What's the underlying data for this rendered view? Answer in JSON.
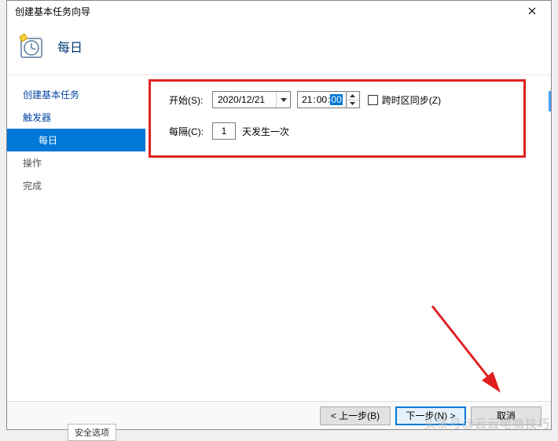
{
  "window": {
    "title": "创建基本任务向导"
  },
  "header": {
    "heading": "每日"
  },
  "sidebar": {
    "items": [
      {
        "label": "创建基本任务"
      },
      {
        "label": "触发器"
      },
      {
        "label": "每日"
      },
      {
        "label": "操作"
      },
      {
        "label": "完成"
      }
    ]
  },
  "form": {
    "start_label": "开始(S):",
    "date_value": "2020/12/21",
    "time_hh": "21",
    "time_mm": "00",
    "time_ss": "00",
    "tz_label": "跨时区同步(Z)",
    "interval_label": "每隔(C):",
    "interval_value": "1",
    "interval_suffix": "天发生一次"
  },
  "footer": {
    "back": "< 上一步(B)",
    "next": "下一步(N) >",
    "cancel": "取消"
  },
  "watermark": "头条号@云云电脑技巧",
  "fragment": "安全选项"
}
